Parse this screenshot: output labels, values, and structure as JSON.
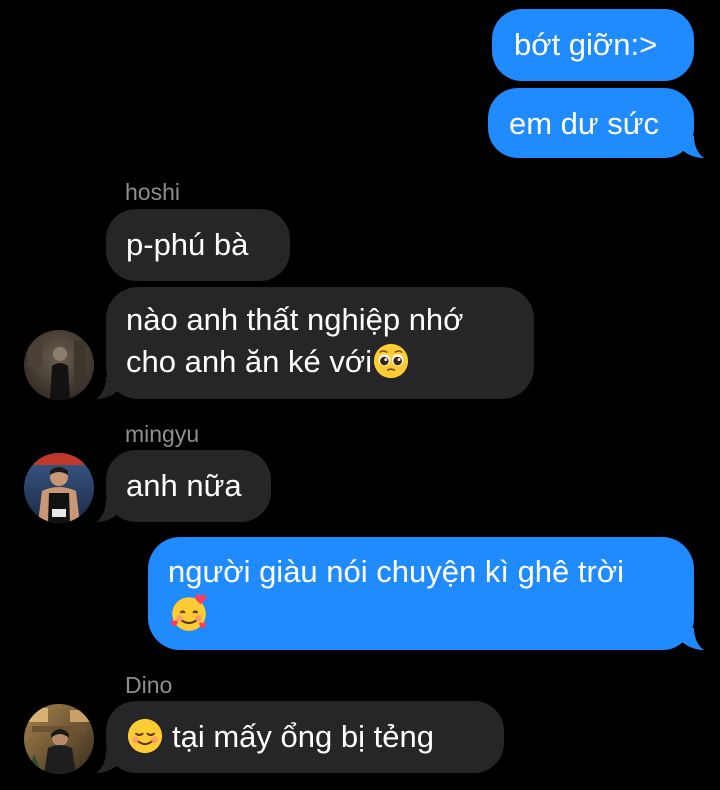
{
  "colors": {
    "background": "#000000",
    "outgoing_bubble": "#1f8bff",
    "incoming_bubble": "#262628",
    "sender_name": "#8e8e93"
  },
  "messages": [
    {
      "direction": "outgoing",
      "text": "bớt giỡn:>"
    },
    {
      "direction": "outgoing",
      "text": "em dư sức"
    },
    {
      "direction": "incoming",
      "sender": "hoshi",
      "text": "p-phú bà"
    },
    {
      "direction": "incoming",
      "sender": "hoshi",
      "line1": "nào anh thất nghiệp nhớ",
      "line2": "cho anh ăn ké với",
      "emoji": "pleading-face-emoji"
    },
    {
      "direction": "incoming",
      "sender": "mingyu",
      "text": "anh nữa"
    },
    {
      "direction": "outgoing",
      "line1": "người giàu nói chuyện kì ghê trời",
      "emoji": "smiling-face-with-hearts-emoji"
    },
    {
      "direction": "incoming",
      "sender": "Dino",
      "emoji": "relieved-smiling-face-emoji",
      "text": "tại mấy ổng bị tẻng"
    }
  ],
  "senders": {
    "hoshi": "hoshi",
    "mingyu": "mingyu",
    "dino": "Dino"
  }
}
